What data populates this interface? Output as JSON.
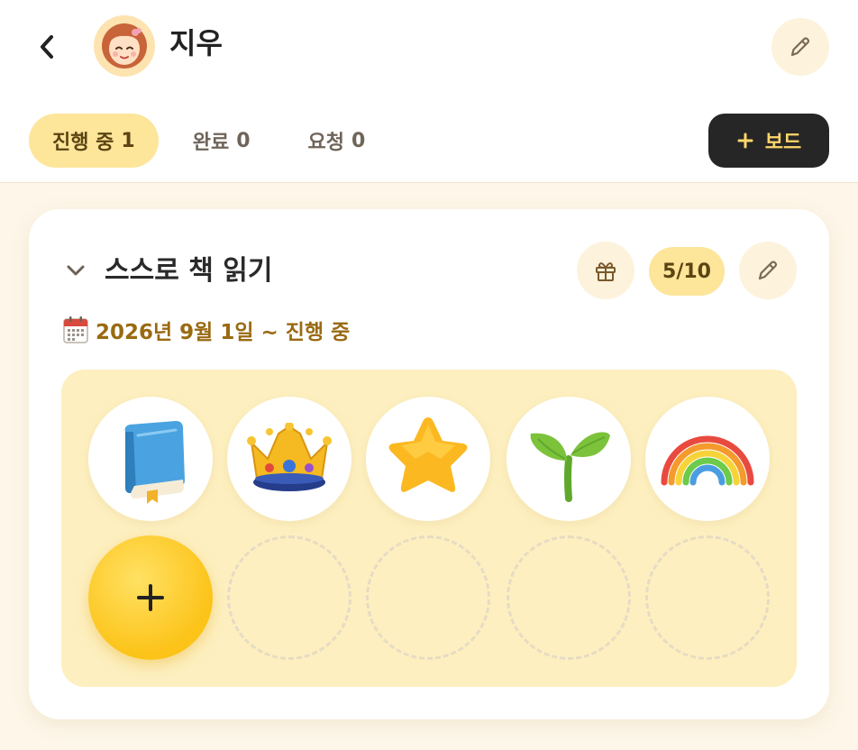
{
  "header": {
    "back_icon": "chevron-left-icon",
    "avatar_icon": "girl-avatar-icon",
    "name": "지우",
    "edit_icon": "pencil-icon"
  },
  "tabs": [
    {
      "label": "진행 중",
      "count": "1",
      "active": true
    },
    {
      "label": "완료",
      "count": "0",
      "active": false
    },
    {
      "label": "요청",
      "count": "0",
      "active": false
    }
  ],
  "add_board": {
    "icon": "plus-icon",
    "label": "보드"
  },
  "board": {
    "collapse_icon": "chevron-down-icon",
    "title": "스스로 책 읽기",
    "gift_icon": "gift-icon",
    "progress": "5/10",
    "edit_icon": "pencil-icon",
    "date_icon": "calendar-icon",
    "date_text": "2026년 9월 1일 ~ 진행 중",
    "stickers": [
      {
        "icon": "book-icon"
      },
      {
        "icon": "crown-icon"
      },
      {
        "icon": "star-icon"
      },
      {
        "icon": "sprout-icon"
      },
      {
        "icon": "rainbow-icon"
      }
    ],
    "add_sticker_icon": "plus-icon",
    "empty_slots": 4
  },
  "colors": {
    "accent": "#fde59a",
    "accent_dark": "#5a4412",
    "date_text": "#9a6a12",
    "button_dark": "#262626",
    "button_text": "#ffd76b",
    "board_bg": "#fdefbf",
    "add_button": "#fcc318"
  }
}
